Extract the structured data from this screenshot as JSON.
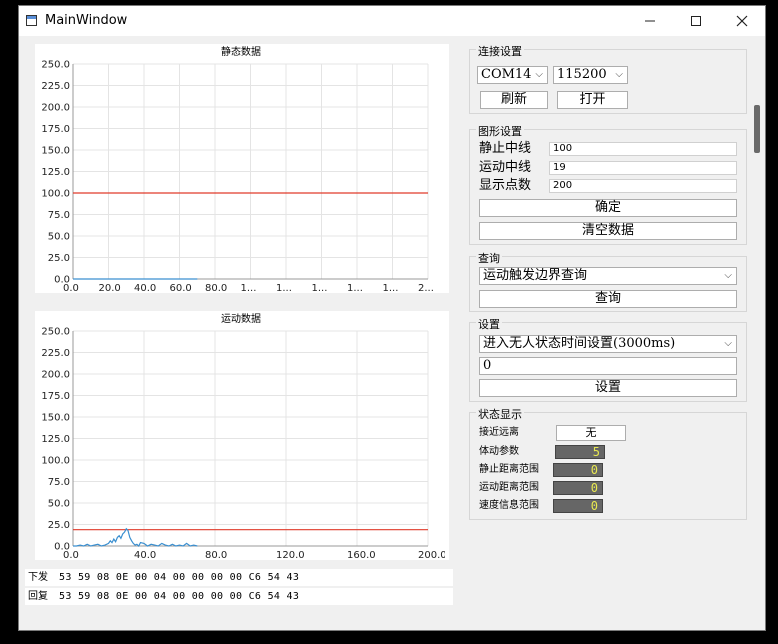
{
  "window": {
    "title": "MainWindow"
  },
  "charts": {
    "static": {
      "title": "静态数据"
    },
    "motion": {
      "title": "运动数据"
    }
  },
  "chart_data": [
    {
      "type": "line",
      "title": "静态数据",
      "ylim": [
        0,
        250
      ],
      "yticks": [
        "250.0",
        "225.0",
        "200.0",
        "175.0",
        "150.0",
        "125.0",
        "100.0",
        "75.0",
        "50.0",
        "25.0",
        "0.0"
      ],
      "xticks": [
        "0.0",
        "20.0",
        "40.0",
        "60.0",
        "80.0",
        "1...",
        "1...",
        "1...",
        "1...",
        "1...",
        "2..."
      ],
      "xlim": [
        0,
        200
      ],
      "grid": true,
      "series": [
        {
          "color": "#e03a2a",
          "x": [
            0,
            200
          ],
          "y": [
            100,
            100
          ]
        },
        {
          "color": "#3a8fd0",
          "x": [
            0,
            10,
            20,
            30,
            40,
            50,
            60,
            70
          ],
          "y": [
            0,
            0,
            0,
            0,
            0,
            0,
            0,
            0
          ]
        }
      ]
    },
    {
      "type": "line",
      "title": "运动数据",
      "ylim": [
        0,
        250
      ],
      "yticks": [
        "250.0",
        "225.0",
        "200.0",
        "175.0",
        "150.0",
        "125.0",
        "100.0",
        "75.0",
        "50.0",
        "25.0",
        "0.0"
      ],
      "xticks": [
        "0.0",
        "40.0",
        "80.0",
        "120.0",
        "160.0",
        "200.0"
      ],
      "xlim": [
        0,
        200
      ],
      "grid": true,
      "series": [
        {
          "color": "#e03a2a",
          "x": [
            0,
            200
          ],
          "y": [
            19,
            19
          ]
        },
        {
          "color": "#3a8fd0",
          "x": [
            0,
            2,
            4,
            6,
            8,
            10,
            12,
            14,
            16,
            18,
            20,
            21,
            22,
            23,
            24,
            25,
            26,
            27,
            28,
            29,
            30,
            31,
            32,
            33,
            34,
            35,
            36,
            37,
            38,
            40,
            42,
            44,
            46,
            48,
            50,
            52,
            54,
            56,
            58,
            60,
            62,
            64,
            66,
            68,
            70
          ],
          "y": [
            0,
            0,
            1,
            0,
            2,
            0,
            1,
            2,
            0,
            1,
            3,
            6,
            4,
            8,
            5,
            10,
            12,
            9,
            14,
            16,
            20,
            18,
            10,
            6,
            3,
            1,
            2,
            0,
            4,
            3,
            0,
            2,
            1,
            0,
            3,
            1,
            0,
            2,
            0,
            1,
            0,
            3,
            0,
            1,
            0
          ]
        }
      ]
    }
  ],
  "log": {
    "sent_label": "下发",
    "sent_value": "53 59 08 0E 00 04 00 00 00 00 C6 54 43",
    "reply_label": "回复",
    "reply_value": "53 59 08 0E 00 04 00 00 00 00 C6 54 43"
  },
  "connection": {
    "title": "连接设置",
    "port": "COM14",
    "baud": "115200",
    "refresh_label": "刷新",
    "open_label": "打开"
  },
  "graph_settings": {
    "title": "图形设置",
    "static_mid_label": "静止中线",
    "static_mid_value": "100",
    "motion_mid_label": "运动中线",
    "motion_mid_value": "19",
    "points_label": "显示点数",
    "points_value": "200",
    "confirm_label": "确定",
    "clear_label": "清空数据"
  },
  "query": {
    "title": "查询",
    "selected": "运动触发边界查询",
    "button_label": "查询"
  },
  "settings": {
    "title": "设置",
    "selected": "进入无人状态时间设置(3000ms)",
    "value": "0",
    "button_label": "设置"
  },
  "status": {
    "title": "状态显示",
    "approach_label": "接近远离",
    "approach_value": "无",
    "body_label": "体动参数",
    "body_value": "5",
    "static_range_label": "静止距离范围",
    "static_range_value": "0",
    "motion_range_label": "运动距离范围",
    "motion_range_value": "0",
    "speed_label": "速度信息范围",
    "speed_value": "0"
  },
  "icons": {
    "arrow": "chevron-down-icon"
  }
}
